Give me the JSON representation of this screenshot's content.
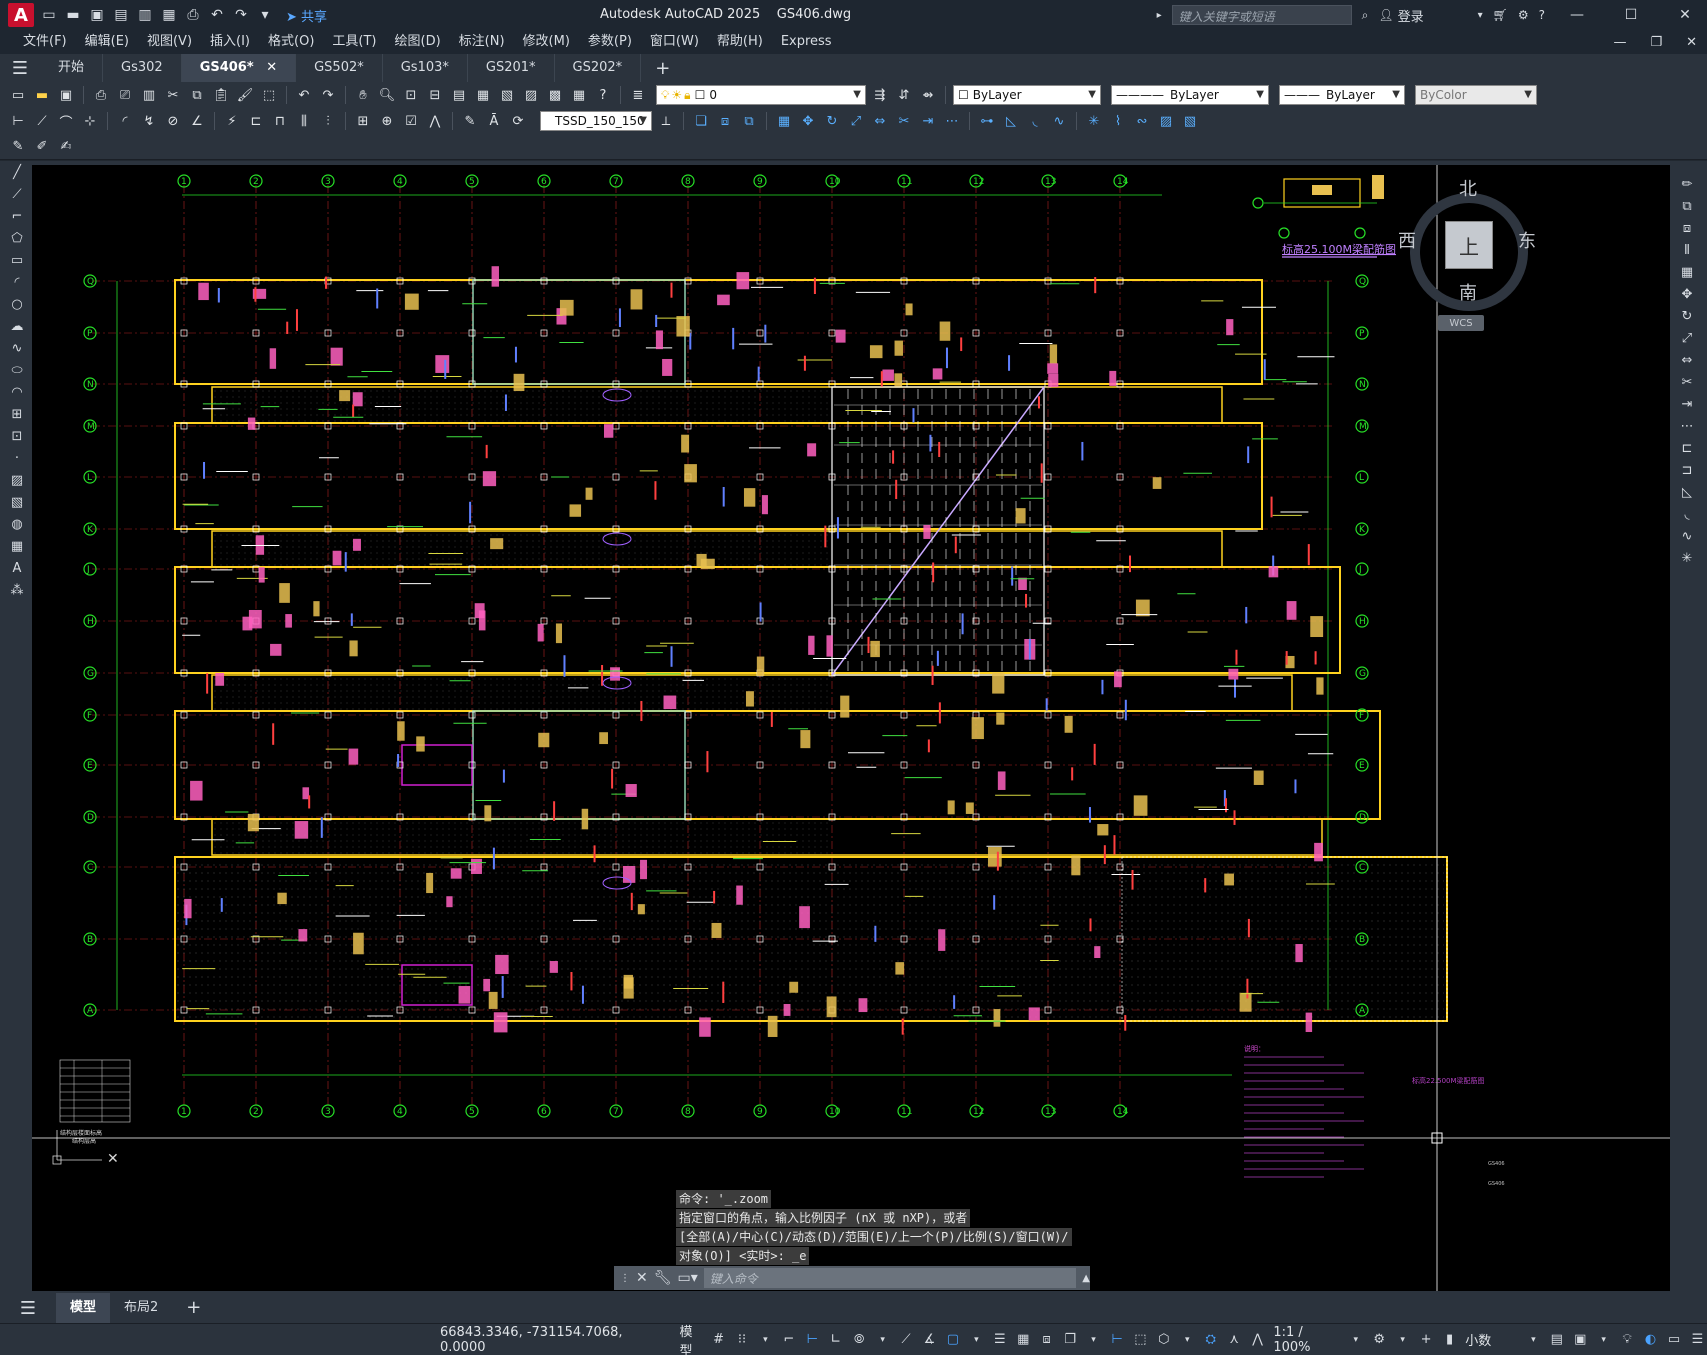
{
  "app": {
    "logo": "A",
    "title": "Autodesk AutoCAD 2025",
    "file": "GS406.dwg",
    "share_label": "共享",
    "search_placeholder": "键入关键字或短语",
    "login_label": "登录"
  },
  "menu": {
    "items": [
      "文件(F)",
      "编辑(E)",
      "视图(V)",
      "插入(I)",
      "格式(O)",
      "工具(T)",
      "绘图(D)",
      "标注(N)",
      "修改(M)",
      "参数(P)",
      "窗口(W)",
      "帮助(H)",
      "Express"
    ]
  },
  "tabs": [
    {
      "label": "开始"
    },
    {
      "label": "Gs302"
    },
    {
      "label": "GS406*",
      "active": true
    },
    {
      "label": "GS502*"
    },
    {
      "label": "Gs103*"
    },
    {
      "label": "GS201*"
    },
    {
      "label": "GS202*"
    }
  ],
  "toolbar": {
    "layer_value": "0",
    "color_value": "ByLayer",
    "linetype_value": "ByLayer",
    "lineweight_value": "ByLayer",
    "plotstyle_value": "ByColor",
    "textstyle_value": "TSSD_150_150"
  },
  "viewcube": {
    "north": "北",
    "south": "南",
    "east": "东",
    "west": "西",
    "face": "上",
    "wcs": "WCS"
  },
  "drawing": {
    "inset_title": "标高25.100M梁配筋图",
    "axis_top": [
      "1",
      "2",
      "3",
      "4",
      "5",
      "6",
      "7",
      "8",
      "9",
      "10",
      "11",
      "12",
      "13",
      "14"
    ],
    "axis_left": [
      "Q",
      "P",
      "N",
      "M",
      "L",
      "K",
      "J",
      "H",
      "G",
      "F",
      "E",
      "D",
      "C",
      "B",
      "A"
    ],
    "legend_title": "结构层楼面标高",
    "legend_sub": "结构层高",
    "notes_title": "说明：",
    "caption_right": "标高22.500M梁配筋图",
    "sheet_code": "GS406"
  },
  "command": {
    "history": [
      "命令: '_.zoom",
      "指定窗口的角点，输入比例因子 (nX 或 nXP)，或者",
      "[全部(A)/中心(C)/动态(D)/范围(E)/上一个(P)/比例(S)/窗口(W)/",
      "对象(O)] <实时>: _e"
    ],
    "input_placeholder": "键入命令"
  },
  "layout_tabs": [
    {
      "label": "模型",
      "active": true
    },
    {
      "label": "布局2"
    }
  ],
  "status": {
    "coordinates": "66843.3346, -731154.7068, 0.0000",
    "space": "模型",
    "scale": "1:1 / 100%",
    "units": "小数"
  },
  "colors": {
    "accent": "#4aa3ff",
    "grid_axis": "#27e027",
    "beam_outline": "#ffd21f",
    "background": "#000000"
  }
}
